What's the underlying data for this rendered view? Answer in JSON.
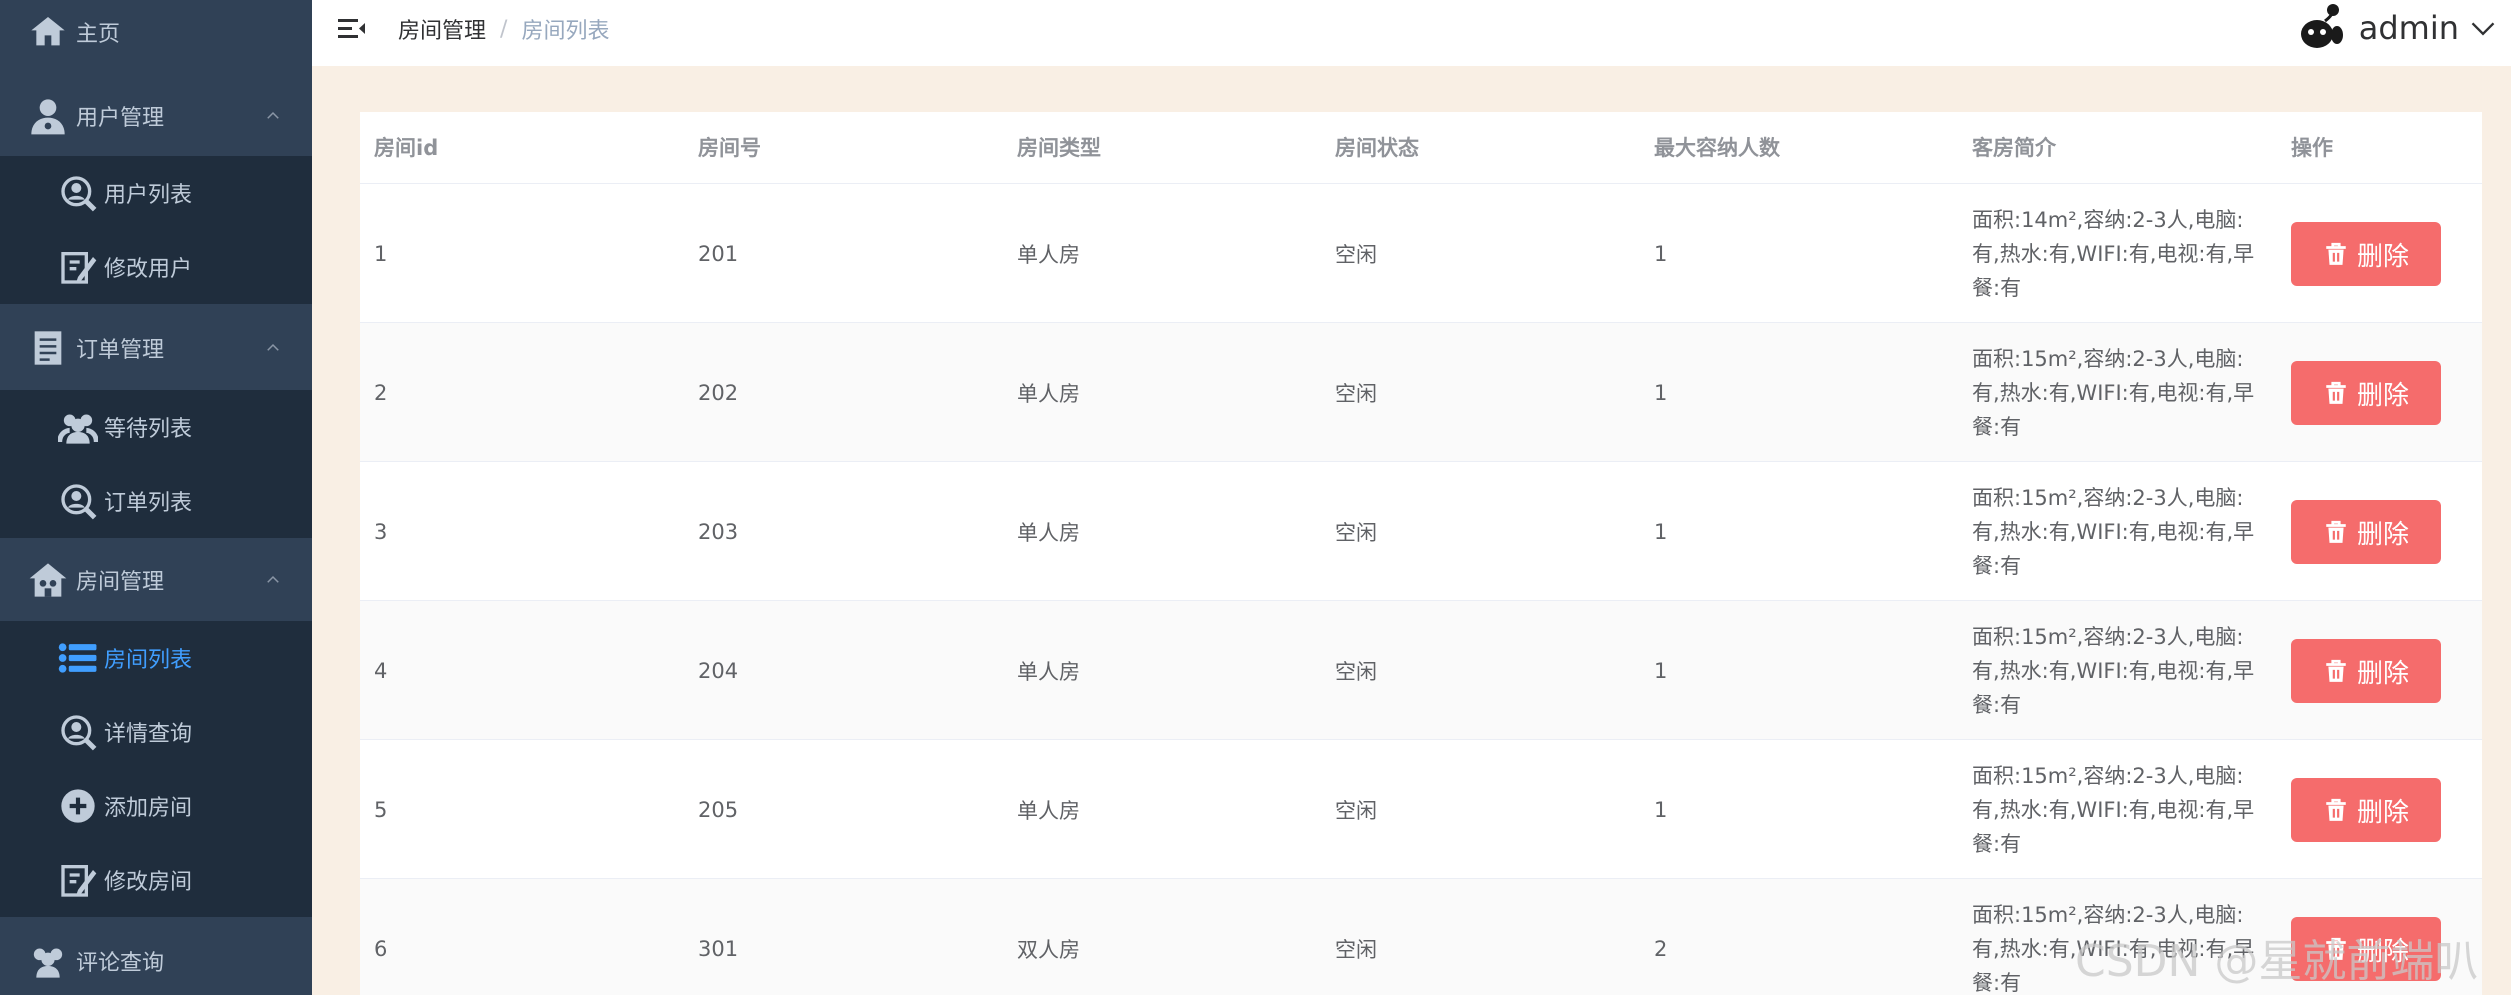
{
  "sidebar": {
    "items": [
      {
        "label": "主页",
        "icon": "home-icon"
      },
      {
        "label": "用户管理",
        "icon": "user-icon",
        "children": [
          {
            "label": "用户列表",
            "icon": "search-icon"
          },
          {
            "label": "修改用户",
            "icon": "edit-icon"
          }
        ]
      },
      {
        "label": "订单管理",
        "icon": "document-icon",
        "children": [
          {
            "label": "等待列表",
            "icon": "group-icon"
          },
          {
            "label": "订单列表",
            "icon": "search-icon"
          }
        ]
      },
      {
        "label": "房间管理",
        "icon": "house-icon",
        "children": [
          {
            "label": "房间列表",
            "icon": "list-icon",
            "active": true
          },
          {
            "label": "详情查询",
            "icon": "search-icon"
          },
          {
            "label": "添加房间",
            "icon": "add-icon"
          },
          {
            "label": "修改房间",
            "icon": "edit-icon"
          }
        ]
      },
      {
        "label": "评论查询",
        "icon": "group-icon"
      }
    ],
    "active_color": "#409eff"
  },
  "header": {
    "breadcrumb": [
      "房间管理",
      "房间列表"
    ],
    "breadcrumb_separator": "/",
    "username": "admin"
  },
  "table": {
    "columns": [
      "房间id",
      "房间号",
      "房间类型",
      "房间状态",
      "最大容纳人数",
      "客房简介",
      "操作"
    ],
    "rows": [
      {
        "id": "1",
        "number": "201",
        "type": "单人房",
        "status": "空闲",
        "capacity": "1",
        "desc": "面积:14m²,容纳:2-3人,电脑:有,热水:有,WIFI:有,电视:有,早餐:有"
      },
      {
        "id": "2",
        "number": "202",
        "type": "单人房",
        "status": "空闲",
        "capacity": "1",
        "desc": "面积:15m²,容纳:2-3人,电脑:有,热水:有,WIFI:有,电视:有,早餐:有"
      },
      {
        "id": "3",
        "number": "203",
        "type": "单人房",
        "status": "空闲",
        "capacity": "1",
        "desc": "面积:15m²,容纳:2-3人,电脑:有,热水:有,WIFI:有,电视:有,早餐:有"
      },
      {
        "id": "4",
        "number": "204",
        "type": "单人房",
        "status": "空闲",
        "capacity": "1",
        "desc": "面积:15m²,容纳:2-3人,电脑:有,热水:有,WIFI:有,电视:有,早餐:有"
      },
      {
        "id": "5",
        "number": "205",
        "type": "单人房",
        "status": "空闲",
        "capacity": "1",
        "desc": "面积:15m²,容纳:2-3人,电脑:有,热水:有,WIFI:有,电视:有,早餐:有"
      },
      {
        "id": "6",
        "number": "301",
        "type": "双人房",
        "status": "空闲",
        "capacity": "2",
        "desc": "面积:15m²,容纳:2-3人,电脑:有,热水:有,WIFI:有,电视:有,早餐:有"
      }
    ],
    "delete_label": "删除",
    "delete_color": "#f56c6c"
  },
  "watermark": "CSDN @星就前端叭"
}
